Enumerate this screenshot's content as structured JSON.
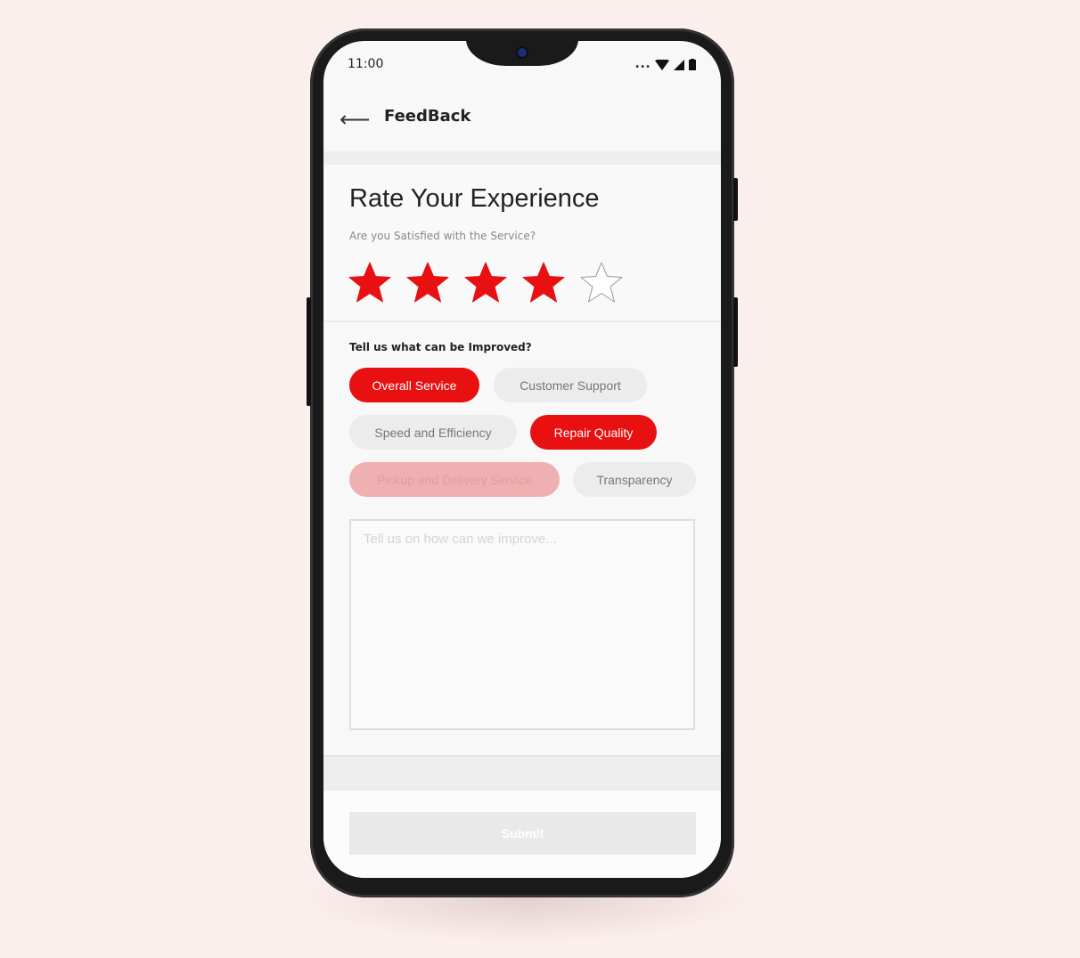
{
  "status_bar": {
    "time": "11:00",
    "icons": [
      "dots-icon",
      "wifi-icon",
      "signal-icon",
      "battery-icon"
    ]
  },
  "header": {
    "back_icon": "arrow-left-icon",
    "back_glyph": "⟵",
    "title": "FeedBack"
  },
  "rating": {
    "title": "Rate Your Experience",
    "subtitle": "Are you Satisfied with the Service?",
    "value": 4,
    "max": 5,
    "color": "#e81010"
  },
  "improve": {
    "label": "Tell us what can be Improved?",
    "chips": [
      {
        "label": "Overall Service",
        "state": "selected"
      },
      {
        "label": "Customer Support",
        "state": "unselected"
      },
      {
        "label": "Speed and Efficiency",
        "state": "unselected"
      },
      {
        "label": "Repair Quality",
        "state": "selected"
      },
      {
        "label": "Pickup and Delivery Service",
        "state": "disabled"
      },
      {
        "label": "Transparency",
        "state": "unselected"
      }
    ]
  },
  "feedback_input": {
    "placeholder": "Tell us on how can we improve...",
    "value": ""
  },
  "submit_label": "Submit"
}
